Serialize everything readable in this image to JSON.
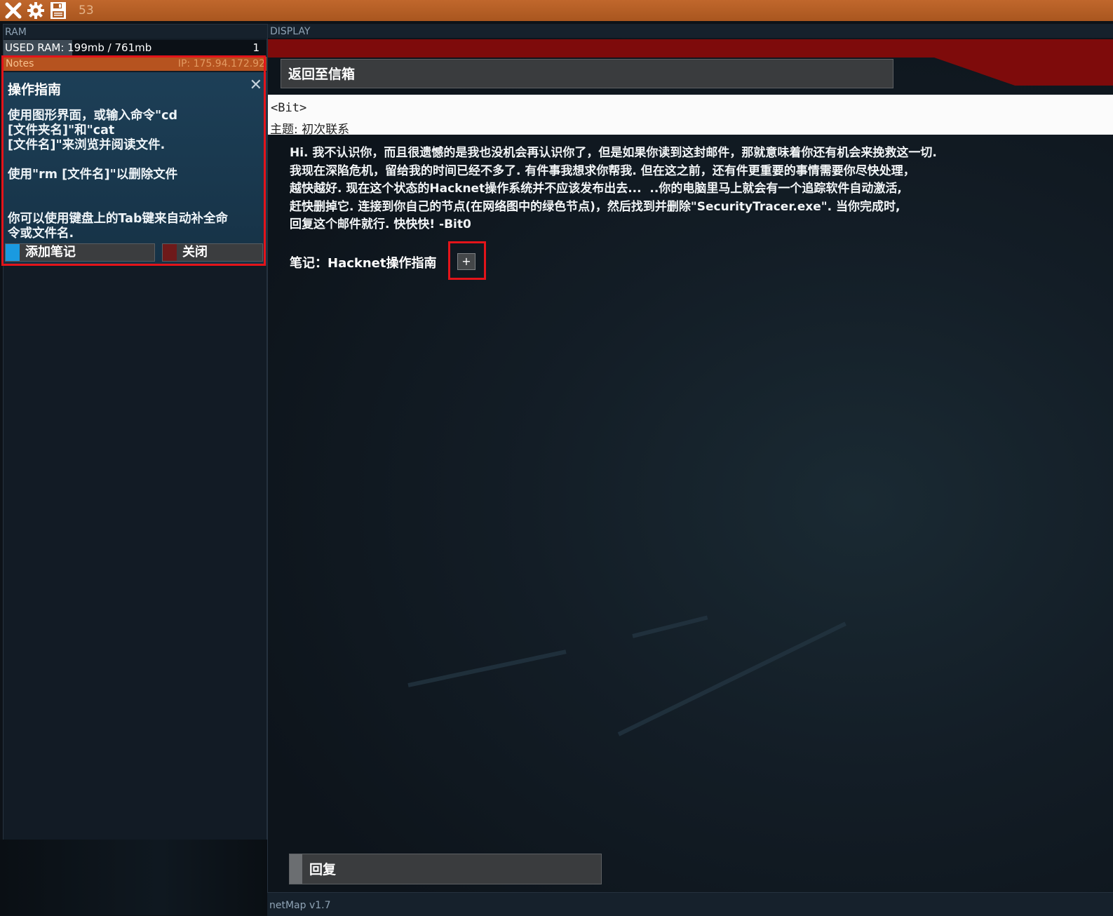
{
  "topbar": {
    "icons": [
      "close-icon",
      "gear-icon",
      "save-icon"
    ],
    "counter": "53"
  },
  "ram": {
    "title": "RAM",
    "used_label": "USED RAM: 199mb / 761mb",
    "used_fraction": 0.261,
    "process_count": "1"
  },
  "notes": {
    "header": "Notes",
    "ip": "IP: 175.94.172.92",
    "note_title": "操作指南",
    "note_body": "使用图形界面，或输入命令\"cd\n[文件夹名]\"和\"cat\n[文件名]\"来浏览并阅读文件.\n\n使用\"rm [文件名]\"以删除文件\n\n\n你可以使用键盘上的Tab键来自动补全命\n令或文件名.",
    "add_button": "添加笔记",
    "close_button": "关闭"
  },
  "display": {
    "title": "DISPLAY",
    "back_button": "返回至信箱",
    "from": "<Bit>",
    "subject": "主题: 初次联系",
    "body": "Hi. 我不认识你，而且很遗憾的是我也没机会再认识你了，但是如果你读到这封邮件，那就意味着你还有机会来挽救这一切.\n我现在深陷危机，留给我的时间已经不多了. 有件事我想求你帮我. 但在这之前，还有件更重要的事情需要你尽快处理，\n越快越好. 现在这个状态的Hacknet操作系统并不应该发布出去...  ..你的电脑里马上就会有一个追踪软件自动激活,\n赶快删掉它. 连接到你自己的节点(在网络图中的绿色节点)，然后找到并删除\"SecurityTracer.exe\". 当你完成时,\n回复这个邮件就行. 快快快! -Bit0",
    "attachment_label": "笔记：Hacknet操作指南",
    "attachment_button": "+",
    "reply_button": "回复"
  },
  "bottom": {
    "label": "netMap v1.7"
  }
}
